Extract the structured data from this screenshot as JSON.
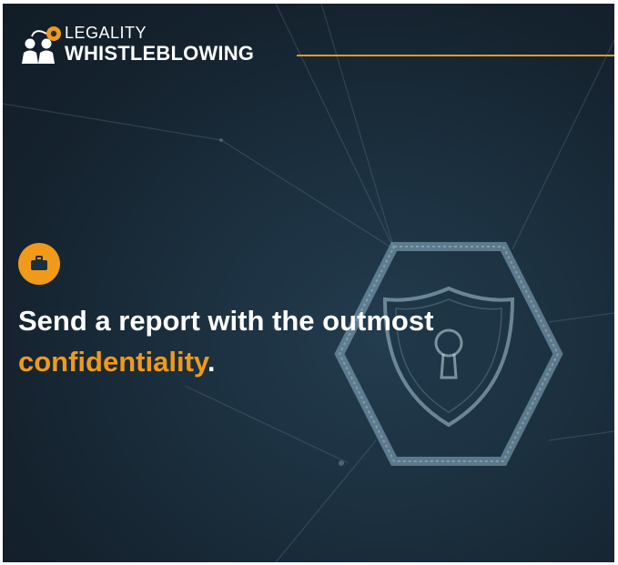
{
  "brand": {
    "line1": "LEGALITY",
    "line2": "WHISTLEBLOWING",
    "accent_color": "#f09a1b"
  },
  "hero": {
    "icon": "briefcase-icon",
    "headline_main": "Send a report with the outmost",
    "headline_accent": "confidentiality",
    "headline_end": "."
  },
  "background": {
    "illustration": "hexagon-shield-keyhole",
    "base_color": "#1b2f3e"
  }
}
